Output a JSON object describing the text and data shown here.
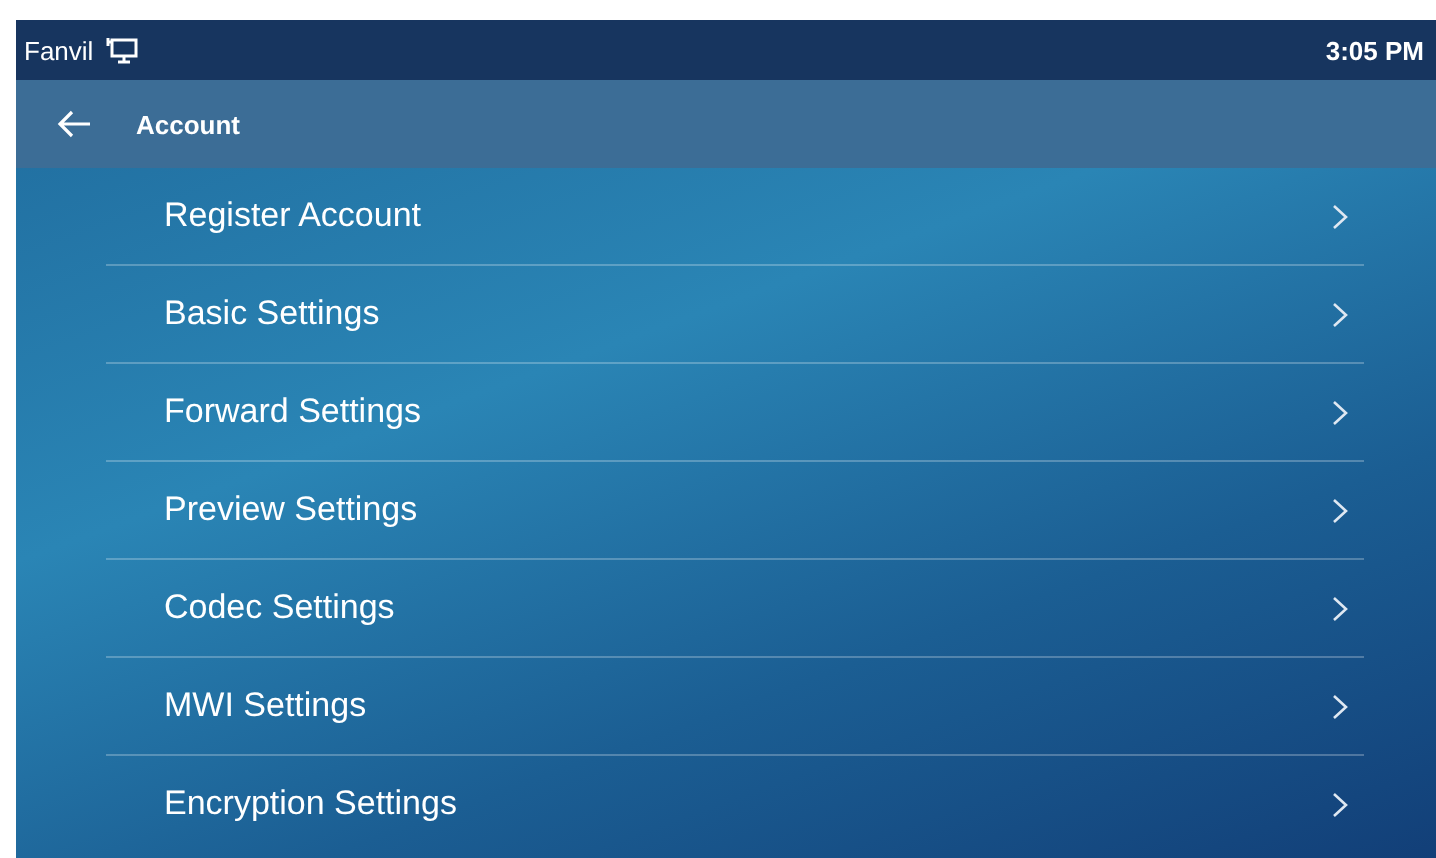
{
  "status_bar": {
    "brand": "Fanvil",
    "time": "3:05 PM"
  },
  "header": {
    "title": "Account"
  },
  "items": [
    {
      "label": "Register Account"
    },
    {
      "label": "Basic Settings"
    },
    {
      "label": "Forward Settings"
    },
    {
      "label": "Preview Settings"
    },
    {
      "label": "Codec Settings"
    },
    {
      "label": "MWI Settings"
    },
    {
      "label": "Encryption Settings"
    }
  ]
}
